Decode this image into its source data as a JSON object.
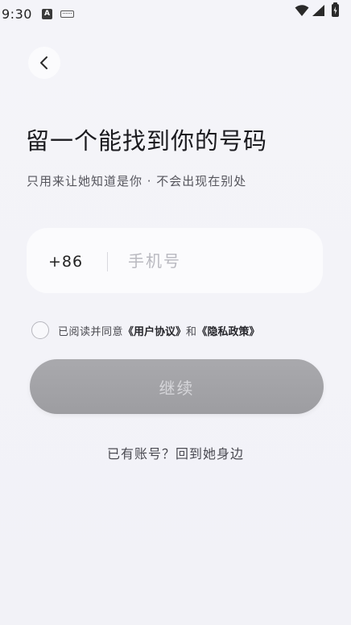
{
  "status_bar": {
    "time": "9:30",
    "notification_icon_letter": "A",
    "icons": [
      "keyboard-icon",
      "wifi-icon",
      "signal-icon",
      "battery-icon"
    ]
  },
  "header": {
    "back_icon": "chevron-left-icon"
  },
  "main": {
    "title": "留一个能找到你的号码",
    "subtitle": "只用来让她知道是你 · 不会出现在别处"
  },
  "phone_field": {
    "country_code": "+86",
    "value": "",
    "placeholder": "手机号"
  },
  "agreement": {
    "checked": false,
    "prefix": "已阅读并同意",
    "user_agreement": "《用户协议》",
    "conjunction": "和",
    "privacy_policy": "《隐私政策》"
  },
  "actions": {
    "continue_label": "继续",
    "login_link": "已有账号？回到她身边"
  },
  "colors": {
    "background": "#f3f3f8",
    "field_background": "#fbfbfd",
    "button_disabled": "#a4a4a8",
    "button_text": "#d6d6da",
    "placeholder": "#b9b9c0"
  }
}
